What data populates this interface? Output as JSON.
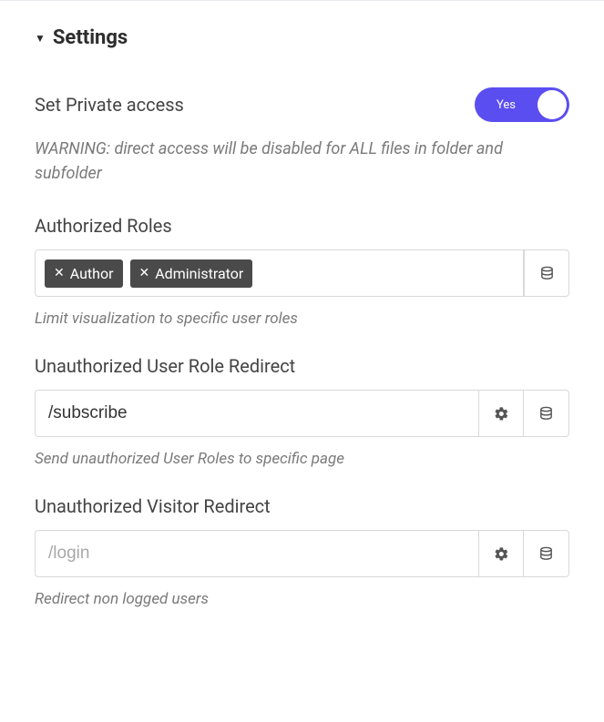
{
  "section": {
    "title": "Settings"
  },
  "private_access": {
    "label": "Set Private access",
    "toggle_text": "Yes",
    "warning": "WARNING: direct access will be disabled for ALL files in folder and subfolder"
  },
  "authorized_roles": {
    "label": "Authorized Roles",
    "tags": [
      "Author",
      "Administrator"
    ],
    "help": "Limit visualization to specific user roles"
  },
  "unauthorized_role_redirect": {
    "label": "Unauthorized User Role Redirect",
    "value": "/subscribe",
    "help": "Send unauthorized User Roles to specific page"
  },
  "unauthorized_visitor_redirect": {
    "label": "Unauthorized Visitor Redirect",
    "placeholder": "/login",
    "help": "Redirect non logged users"
  }
}
